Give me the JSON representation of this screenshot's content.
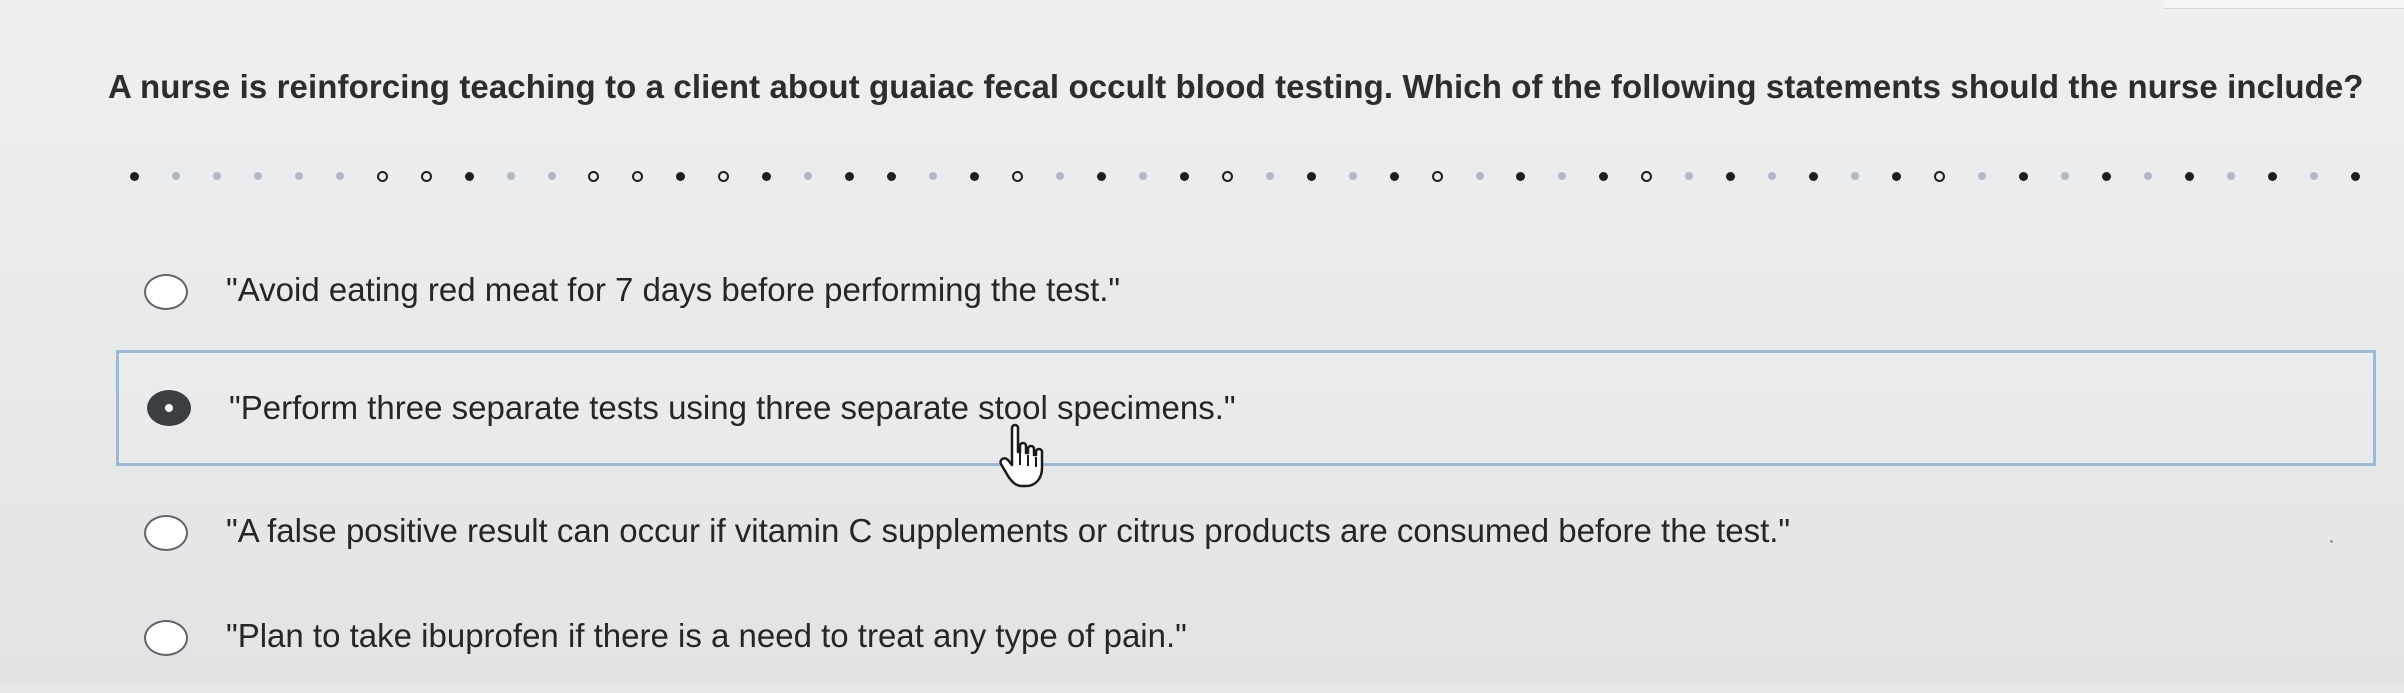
{
  "question": {
    "text": "A nurse is reinforcing teaching to a client about guaiac fecal occult blood testing. Which of the following statements should the nurse include?"
  },
  "options": [
    {
      "text": "\"Avoid eating red meat for 7 days before performing the test.\"",
      "selected": false
    },
    {
      "text": "\"Perform three separate tests using three separate stool specimens.\"",
      "selected": true
    },
    {
      "text": "\"A false positive result can occur if vitamin C supplements or citrus products are consumed before the test.\"",
      "selected": false
    },
    {
      "text": "\"Plan to take ibuprofen if there is a need to treat any type of pain.\"",
      "selected": false
    }
  ],
  "icons": {
    "cursor": "hand-pointer-icon",
    "radio_unselected": "radio-empty-icon",
    "radio_selected": "radio-filled-icon"
  },
  "colors": {
    "background": "#e8e9eb",
    "selected_border": "#9fb9d4",
    "radio_checked": "#3b3e43"
  }
}
